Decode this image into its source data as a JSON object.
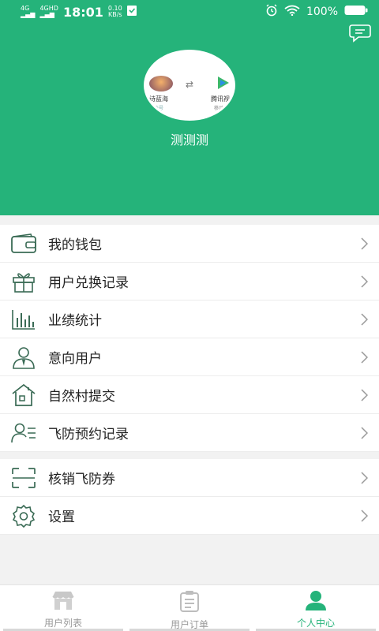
{
  "status_bar": {
    "signal1": "4G",
    "signal2": "4GHD",
    "time": "18:01",
    "speed_value": "0.10",
    "speed_unit": "KB/s",
    "battery": "100%"
  },
  "header": {
    "username": "测测测",
    "avatar_left_label": "诗蓝海",
    "avatar_left_sub": "小账号",
    "avatar_right_label": "腾讯视",
    "avatar_right_sub": "移动",
    "swap_symbol": "⇄"
  },
  "menu": {
    "group1": [
      {
        "label": "我的钱包",
        "icon": "wallet-icon"
      },
      {
        "label": "用户兑换记录",
        "icon": "gift-icon"
      },
      {
        "label": "业绩统计",
        "icon": "bar-chart-icon"
      },
      {
        "label": "意向用户",
        "icon": "user-tie-icon"
      },
      {
        "label": "自然村提交",
        "icon": "house-icon"
      },
      {
        "label": "飞防预约记录",
        "icon": "user-list-icon"
      }
    ],
    "group2": [
      {
        "label": "核销飞防券",
        "icon": "scan-icon"
      },
      {
        "label": "设置",
        "icon": "gear-icon"
      }
    ]
  },
  "tabbar": {
    "tabs": [
      {
        "label": "用户列表",
        "icon": "store-icon",
        "active": false
      },
      {
        "label": "用户订单",
        "icon": "clipboard-icon",
        "active": false
      },
      {
        "label": "个人中心",
        "icon": "person-icon",
        "active": true
      }
    ]
  },
  "colors": {
    "accent": "#25b37a",
    "icon_stroke": "#3a6b55",
    "inactive": "#999999"
  }
}
